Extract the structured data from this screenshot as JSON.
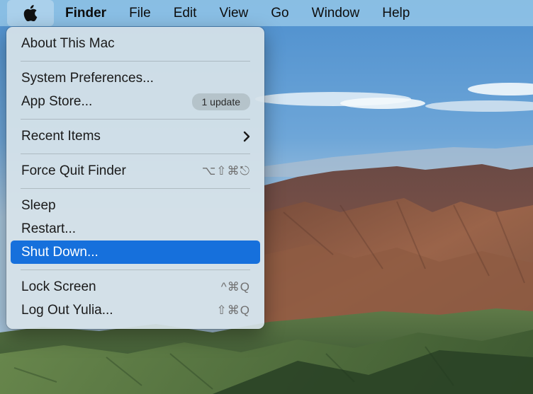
{
  "menubar": {
    "apple_icon": "apple-logo-icon",
    "items": [
      "Finder",
      "File",
      "Edit",
      "View",
      "Go",
      "Window",
      "Help"
    ]
  },
  "apple_menu": {
    "about": "About This Mac",
    "system_preferences": "System Preferences...",
    "app_store": {
      "label": "App Store...",
      "badge": "1 update"
    },
    "recent_items": {
      "label": "Recent Items",
      "icon": "chevron-right-icon"
    },
    "force_quit": {
      "label": "Force Quit Finder",
      "shortcut": "⌥⇧⌘⎋"
    },
    "sleep": "Sleep",
    "restart": "Restart...",
    "shut_down": "Shut Down...",
    "lock_screen": {
      "label": "Lock Screen",
      "shortcut": "^⌘Q"
    },
    "log_out": {
      "label": "Log Out Yulia...",
      "shortcut": "⇧⌘Q"
    }
  },
  "colors": {
    "highlight": "#1670dc",
    "menubar": "#96c8e8",
    "menu_background": "#d6e2e8"
  }
}
